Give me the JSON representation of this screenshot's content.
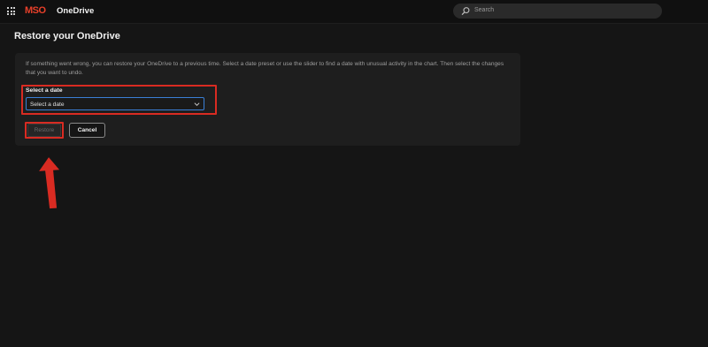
{
  "header": {
    "brand": "MSO",
    "app_title": "OneDrive",
    "search_placeholder": "Search"
  },
  "page": {
    "title": "Restore your OneDrive",
    "description": "If something went wrong, you can restore your OneDrive to a previous time. Select a date preset or use the slider to find a date with unusual activity in the chart. Then select the changes that you want to undo."
  },
  "form": {
    "date_label": "Select a date",
    "date_value": "Select a date"
  },
  "buttons": {
    "restore_label": "Restore",
    "cancel_label": "Cancel"
  },
  "icons": {
    "apps": "app-launcher-icon",
    "search": "search-icon",
    "dropdown": "chevron-down-icon",
    "annotation": "red-arrow-icon"
  },
  "colors": {
    "annotation_red": "#d92b22",
    "focus_blue": "#3b7fd6",
    "brand_red": "#e8402a"
  }
}
